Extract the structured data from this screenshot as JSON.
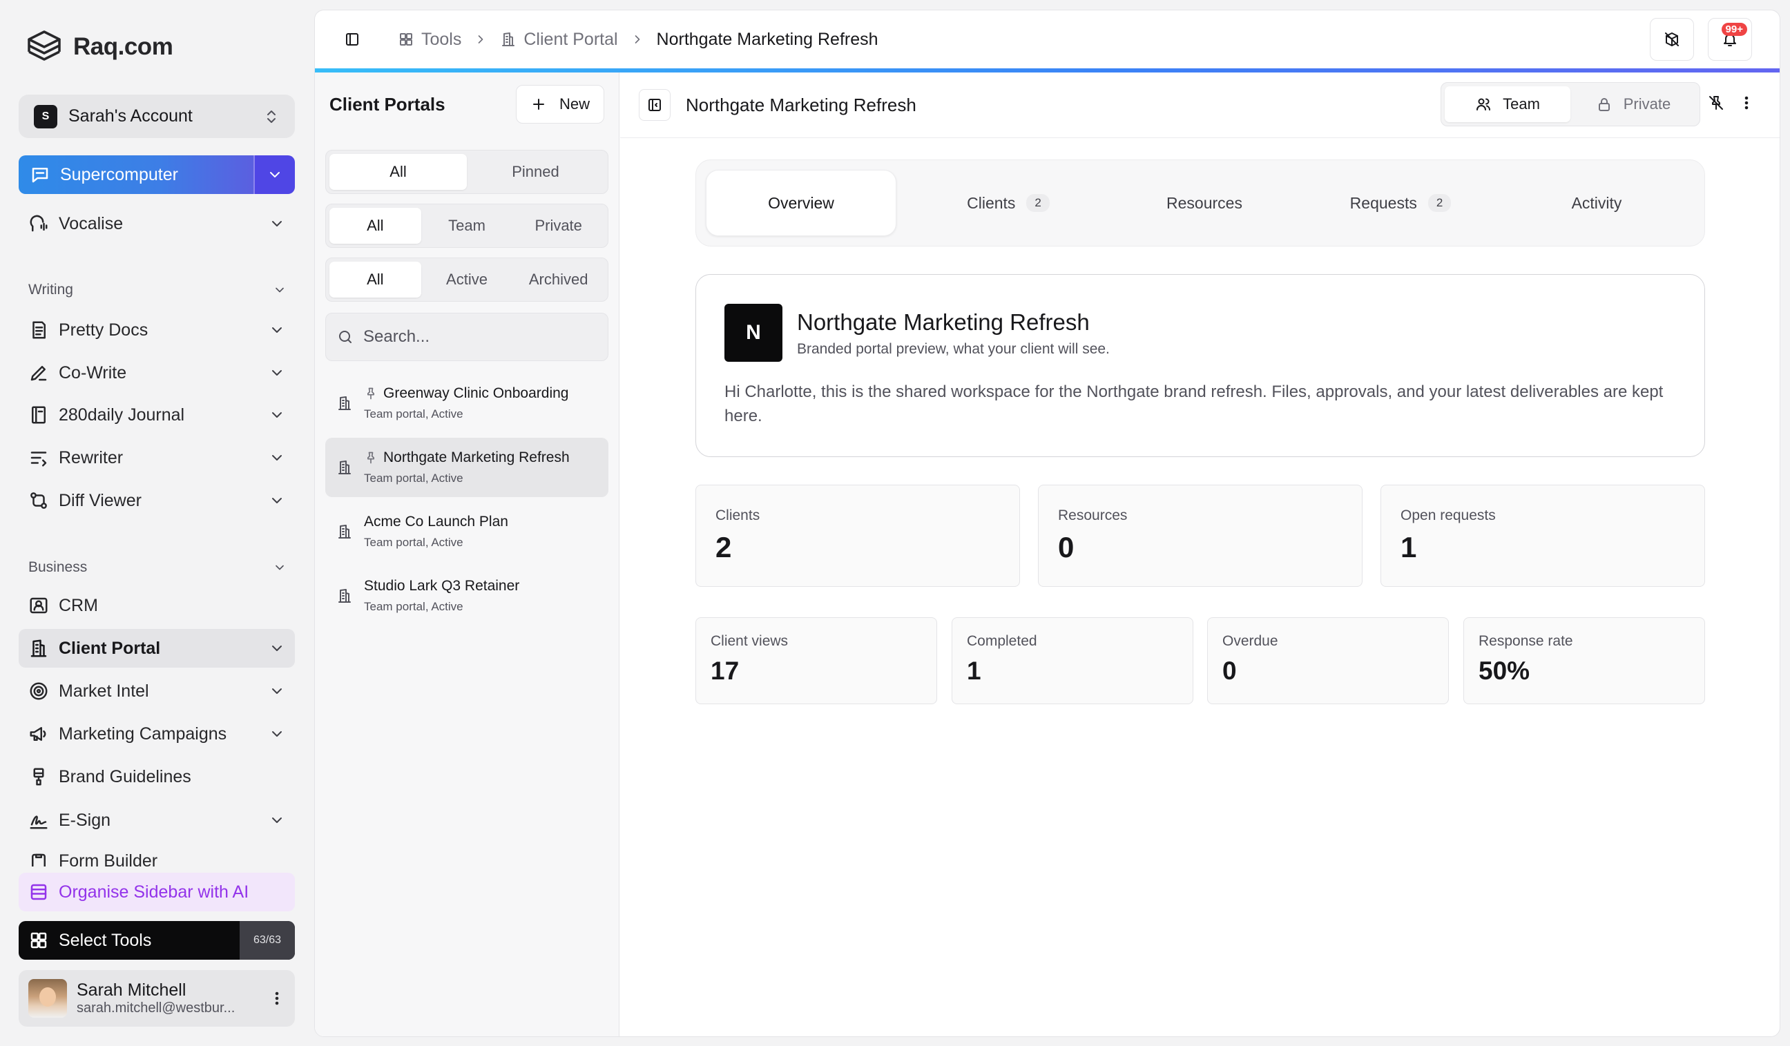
{
  "app": {
    "name": "Raq.com"
  },
  "account": {
    "initial": "S",
    "name": "Sarah's Account"
  },
  "sidebar": {
    "supercomputer_label": "Supercomputer",
    "vocalise_label": "Vocalise",
    "writing_section": "Writing",
    "writing_items": [
      "Pretty Docs",
      "Co-Write",
      "280daily Journal",
      "Rewriter",
      "Diff Viewer"
    ],
    "business_section": "Business",
    "business_items": [
      "CRM",
      "Client Portal",
      "Market Intel",
      "Marketing Campaigns",
      "Brand Guidelines",
      "E-Sign",
      "Form Builder"
    ],
    "organise_label": "Organise Sidebar with AI",
    "select_tools_label": "Select Tools",
    "select_tools_count": "63/63"
  },
  "user": {
    "name": "Sarah Mitchell",
    "email": "sarah.mitchell@westbur..."
  },
  "breadcrumb": {
    "tools": "Tools",
    "client_portal": "Client Portal",
    "current": "Northgate Marketing Refresh"
  },
  "notifications": {
    "badge": "99+"
  },
  "list": {
    "title": "Client Portals",
    "new_label": "New",
    "filter1": [
      "All",
      "Pinned"
    ],
    "filter2": [
      "All",
      "Team",
      "Private"
    ],
    "filter3": [
      "All",
      "Active",
      "Archived"
    ],
    "search_placeholder": "Search...",
    "portals": [
      {
        "title": "Greenway Clinic Onboarding",
        "sub": "Team portal, Active",
        "pinned": true
      },
      {
        "title": "Northgate Marketing Refresh",
        "sub": "Team portal, Active",
        "pinned": true
      },
      {
        "title": "Acme Co Launch Plan",
        "sub": "Team portal, Active",
        "pinned": false
      },
      {
        "title": "Studio Lark Q3 Retainer",
        "sub": "Team portal, Active",
        "pinned": false
      }
    ]
  },
  "content": {
    "title": "Northgate Marketing Refresh",
    "visibility": {
      "team": "Team",
      "private": "Private",
      "selected": "Team"
    },
    "tabs": [
      {
        "label": "Overview",
        "count": ""
      },
      {
        "label": "Clients",
        "count": "2"
      },
      {
        "label": "Resources",
        "count": ""
      },
      {
        "label": "Requests",
        "count": "2"
      },
      {
        "label": "Activity",
        "count": ""
      }
    ],
    "preview": {
      "initial": "N",
      "title": "Northgate Marketing Refresh",
      "subtitle": "Branded portal preview, what your client will see.",
      "message": "Hi Charlotte, this is the shared workspace for the Northgate brand refresh. Files, approvals, and your latest deliverables are kept here."
    },
    "stats": [
      {
        "label": "Clients",
        "value": "2"
      },
      {
        "label": "Resources",
        "value": "0"
      },
      {
        "label": "Open requests",
        "value": "1"
      }
    ],
    "stats2": [
      {
        "label": "Client views",
        "value": "17"
      },
      {
        "label": "Completed",
        "value": "1"
      },
      {
        "label": "Overdue",
        "value": "0"
      },
      {
        "label": "Response rate",
        "value": "50%"
      }
    ]
  },
  "colors": {
    "accent": "#4f46e5",
    "organise": "#9333ea",
    "badge": "#ef4444"
  }
}
